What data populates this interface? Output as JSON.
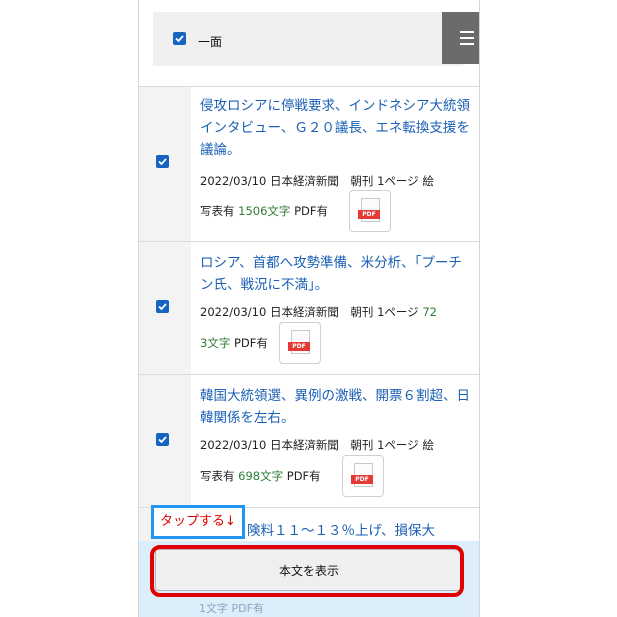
{
  "header": {
    "label": "一面"
  },
  "articles": [
    {
      "title": "侵攻ロシアに停戦要求、インドネシア大統領インタビュー、Ｇ２０議長、エネ転換支援を議論。",
      "meta_line1": "2022/03/10 日本経済新聞　朝刊 1ページ 絵",
      "meta_line2_prefix": "写表有",
      "chars": "1506文字",
      "pdf": "PDF有"
    },
    {
      "title": "ロシア、首都へ攻勢準備、米分析、「プーチン氏、戦況に不満」。",
      "meta_line1": "2022/03/10 日本経済新聞　朝刊 1ページ",
      "chars_part1": "72",
      "chars_part2": "3文字",
      "pdf": "PDF有"
    },
    {
      "title": "韓国大統領選、異例の激戦、開票６割超、日韓関係を左右。",
      "meta_line1": "2022/03/10 日本経済新聞　朝刊 1ページ 絵",
      "meta_line2_prefix": "写表有",
      "chars": "698文字",
      "pdf": "PDF有"
    },
    {
      "title_partial": "険料１１～１３％上げ、損保大"
    }
  ],
  "pdf_tag": "PDF",
  "bottom": {
    "button_label": "本文を表示",
    "underlay_text": "1文字 PDF有"
  },
  "annotation": {
    "label": "タップする↓"
  },
  "colors": {
    "accent": "#1565c0",
    "title": "#1a5fb4",
    "chars": "#2e7d32",
    "highlight": "#e00000",
    "label_border": "#2196f3"
  }
}
